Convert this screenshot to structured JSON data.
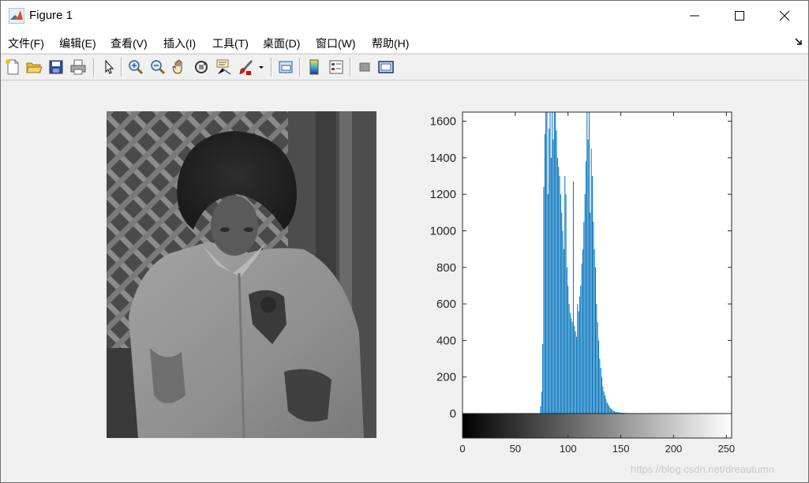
{
  "window": {
    "title": "Figure 1"
  },
  "menu": [
    {
      "label": "文件(F)"
    },
    {
      "label": "编辑(E)"
    },
    {
      "label": "查看(V)"
    },
    {
      "label": "插入(I)"
    },
    {
      "label": "工具(T)"
    },
    {
      "label": "桌面(D)"
    },
    {
      "label": "窗口(W)"
    },
    {
      "label": "帮助(H)"
    }
  ],
  "toolbar": {
    "items": [
      "new-figure-icon",
      "open-file-icon",
      "save-icon",
      "print-icon",
      "pointer-icon",
      "zoom-in-icon",
      "zoom-out-icon",
      "pan-hand-icon",
      "rotate-3d-icon",
      "data-cursor-icon",
      "brush-icon",
      "brush-dropdown-icon",
      "link-plot-icon",
      "colorbar-icon",
      "legend-icon",
      "hide-plot-tools-icon",
      "show-plot-tools-icon"
    ]
  },
  "chart_data": {
    "type": "bar",
    "title": "",
    "xlabel": "",
    "ylabel": "",
    "xlim": [
      0,
      255
    ],
    "ylim": [
      0,
      1650
    ],
    "yticks": [
      0,
      200,
      400,
      600,
      800,
      1000,
      1200,
      1400,
      1600
    ],
    "xticks": [
      0,
      50,
      100,
      150,
      200,
      250
    ],
    "bar_color": "#0072bd",
    "colorbar": "gray",
    "x": [
      74,
      75,
      76,
      77,
      78,
      79,
      80,
      81,
      82,
      83,
      84,
      85,
      86,
      87,
      88,
      89,
      90,
      91,
      92,
      93,
      94,
      95,
      96,
      97,
      98,
      99,
      100,
      101,
      102,
      103,
      104,
      105,
      106,
      107,
      108,
      109,
      110,
      111,
      112,
      113,
      114,
      115,
      116,
      117,
      118,
      119,
      120,
      121,
      122,
      123,
      124,
      125,
      126,
      127,
      128,
      129,
      130,
      131,
      132,
      133,
      134,
      135,
      136,
      137,
      138,
      139,
      140,
      141,
      142,
      143,
      144,
      145,
      146,
      147,
      148,
      149,
      150,
      151,
      152,
      153,
      154,
      155,
      156,
      157,
      158,
      159,
      160,
      161,
      162,
      163,
      164,
      165,
      166,
      167,
      168,
      169,
      170,
      175,
      180,
      185,
      190,
      195,
      200,
      205,
      210
    ],
    "values": [
      40,
      120,
      380,
      1240,
      1530,
      1650,
      1650,
      1200,
      1560,
      1650,
      1400,
      1650,
      1500,
      1650,
      1650,
      1550,
      1400,
      1350,
      1300,
      1200,
      1100,
      1000,
      900,
      1300,
      1200,
      800,
      700,
      600,
      550,
      520,
      500,
      1270,
      480,
      450,
      420,
      600,
      560,
      640,
      700,
      820,
      900,
      1050,
      1200,
      1380,
      1650,
      1500,
      1650,
      1100,
      1450,
      1300,
      1050,
      900,
      800,
      600,
      500,
      400,
      300,
      250,
      200,
      150,
      120,
      100,
      80,
      60,
      50,
      40,
      30,
      25,
      20,
      15,
      12,
      10,
      8,
      8,
      6,
      6,
      5,
      5,
      4,
      4,
      3,
      3,
      3,
      2,
      2,
      2,
      2,
      1,
      1,
      1,
      1,
      1,
      1,
      1,
      1,
      1,
      1,
      1,
      1,
      1,
      1,
      1,
      1,
      1,
      1
    ]
  },
  "watermark": "https://blog.csdn.net/dreautumn"
}
